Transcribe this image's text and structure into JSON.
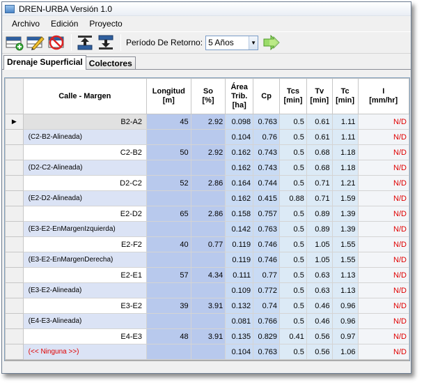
{
  "window": {
    "title": "DREN-URBA Versión 1.0"
  },
  "menu": [
    "Archivo",
    "Edición",
    "Proyecto"
  ],
  "toolbar": {
    "buttons": [
      "add-row-icon",
      "edit-pencil-icon",
      "delete-icon",
      "move-up-icon",
      "move-down-icon"
    ],
    "period_label": "Período De Retorno:",
    "period_value": "5 Años",
    "run_icon": "green-arrow-icon"
  },
  "tabs": [
    "Drenaje Superficial",
    "Colectores"
  ],
  "grid": {
    "headers": {
      "calle": "Calle - Margen",
      "longitud": "Longitud\n[m]",
      "so": "So\n[%]",
      "area": "Área\nTrib.\n[ha]",
      "cp": "Cp",
      "tcs": "Tcs\n[min]",
      "tv": "Tv\n[min]",
      "tc": "Tc\n[min]",
      "i": "I\n[mm/hr]"
    },
    "rows": [
      {
        "calle": "B2-A2",
        "longitud": "45",
        "so": "2.92",
        "area": "0.098",
        "cp": "0.763",
        "tcs": "0.5",
        "tv": "0.61",
        "tc": "1.11",
        "i": "N/D",
        "sub": false,
        "selected": true
      },
      {
        "calle": "(C2-B2-Alineada)",
        "longitud": "",
        "so": "",
        "area": "0.104",
        "cp": "0.76",
        "tcs": "0.5",
        "tv": "0.61",
        "tc": "1.11",
        "i": "N/D",
        "sub": true
      },
      {
        "calle": "C2-B2",
        "longitud": "50",
        "so": "2.92",
        "area": "0.162",
        "cp": "0.743",
        "tcs": "0.5",
        "tv": "0.68",
        "tc": "1.18",
        "i": "N/D",
        "sub": false
      },
      {
        "calle": "(D2-C2-Alineada)",
        "longitud": "",
        "so": "",
        "area": "0.162",
        "cp": "0.743",
        "tcs": "0.5",
        "tv": "0.68",
        "tc": "1.18",
        "i": "N/D",
        "sub": true
      },
      {
        "calle": "D2-C2",
        "longitud": "52",
        "so": "2.86",
        "area": "0.164",
        "cp": "0.744",
        "tcs": "0.5",
        "tv": "0.71",
        "tc": "1.21",
        "i": "N/D",
        "sub": false
      },
      {
        "calle": "(E2-D2-Alineada)",
        "longitud": "",
        "so": "",
        "area": "0.162",
        "cp": "0.415",
        "tcs": "0.88",
        "tv": "0.71",
        "tc": "1.59",
        "i": "N/D",
        "sub": true
      },
      {
        "calle": "E2-D2",
        "longitud": "65",
        "so": "2.86",
        "area": "0.158",
        "cp": "0.757",
        "tcs": "0.5",
        "tv": "0.89",
        "tc": "1.39",
        "i": "N/D",
        "sub": false
      },
      {
        "calle": "(E3-E2-EnMargenIzquierda)",
        "longitud": "",
        "so": "",
        "area": "0.142",
        "cp": "0.763",
        "tcs": "0.5",
        "tv": "0.89",
        "tc": "1.39",
        "i": "N/D",
        "sub": true
      },
      {
        "calle": "E2-F2",
        "longitud": "40",
        "so": "0.77",
        "area": "0.119",
        "cp": "0.746",
        "tcs": "0.5",
        "tv": "1.05",
        "tc": "1.55",
        "i": "N/D",
        "sub": false
      },
      {
        "calle": "(E3-E2-EnMargenDerecha)",
        "longitud": "",
        "so": "",
        "area": "0.119",
        "cp": "0.746",
        "tcs": "0.5",
        "tv": "1.05",
        "tc": "1.55",
        "i": "N/D",
        "sub": true
      },
      {
        "calle": "E2-E1",
        "longitud": "57",
        "so": "4.34",
        "area": "0.111",
        "cp": "0.77",
        "tcs": "0.5",
        "tv": "0.63",
        "tc": "1.13",
        "i": "N/D",
        "sub": false
      },
      {
        "calle": "(E3-E2-Alineada)",
        "longitud": "",
        "so": "",
        "area": "0.109",
        "cp": "0.772",
        "tcs": "0.5",
        "tv": "0.63",
        "tc": "1.13",
        "i": "N/D",
        "sub": true
      },
      {
        "calle": "E3-E2",
        "longitud": "39",
        "so": "3.91",
        "area": "0.132",
        "cp": "0.74",
        "tcs": "0.5",
        "tv": "0.46",
        "tc": "0.96",
        "i": "N/D",
        "sub": false
      },
      {
        "calle": "(E4-E3-Alineada)",
        "longitud": "",
        "so": "",
        "area": "0.081",
        "cp": "0.766",
        "tcs": "0.5",
        "tv": "0.46",
        "tc": "0.96",
        "i": "N/D",
        "sub": true
      },
      {
        "calle": "E4-E3",
        "longitud": "48",
        "so": "3.91",
        "area": "0.135",
        "cp": "0.829",
        "tcs": "0.41",
        "tv": "0.56",
        "tc": "0.97",
        "i": "N/D",
        "sub": false
      },
      {
        "calle": "(<< Ninguna >>)",
        "longitud": "",
        "so": "",
        "area": "0.104",
        "cp": "0.763",
        "tcs": "0.5",
        "tv": "0.56",
        "tc": "1.06",
        "i": "N/D",
        "sub": true,
        "red": true
      }
    ]
  }
}
